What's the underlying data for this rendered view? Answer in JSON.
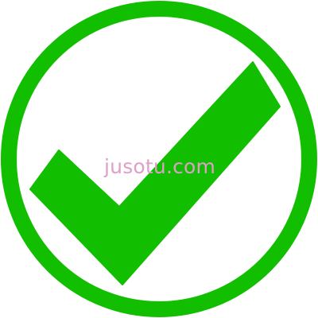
{
  "icon": {
    "name": "check-circle-icon",
    "color": "#12be00",
    "background": "#ffffff"
  },
  "watermark": {
    "text": "jusotu.com",
    "color": "#dda0c8"
  }
}
